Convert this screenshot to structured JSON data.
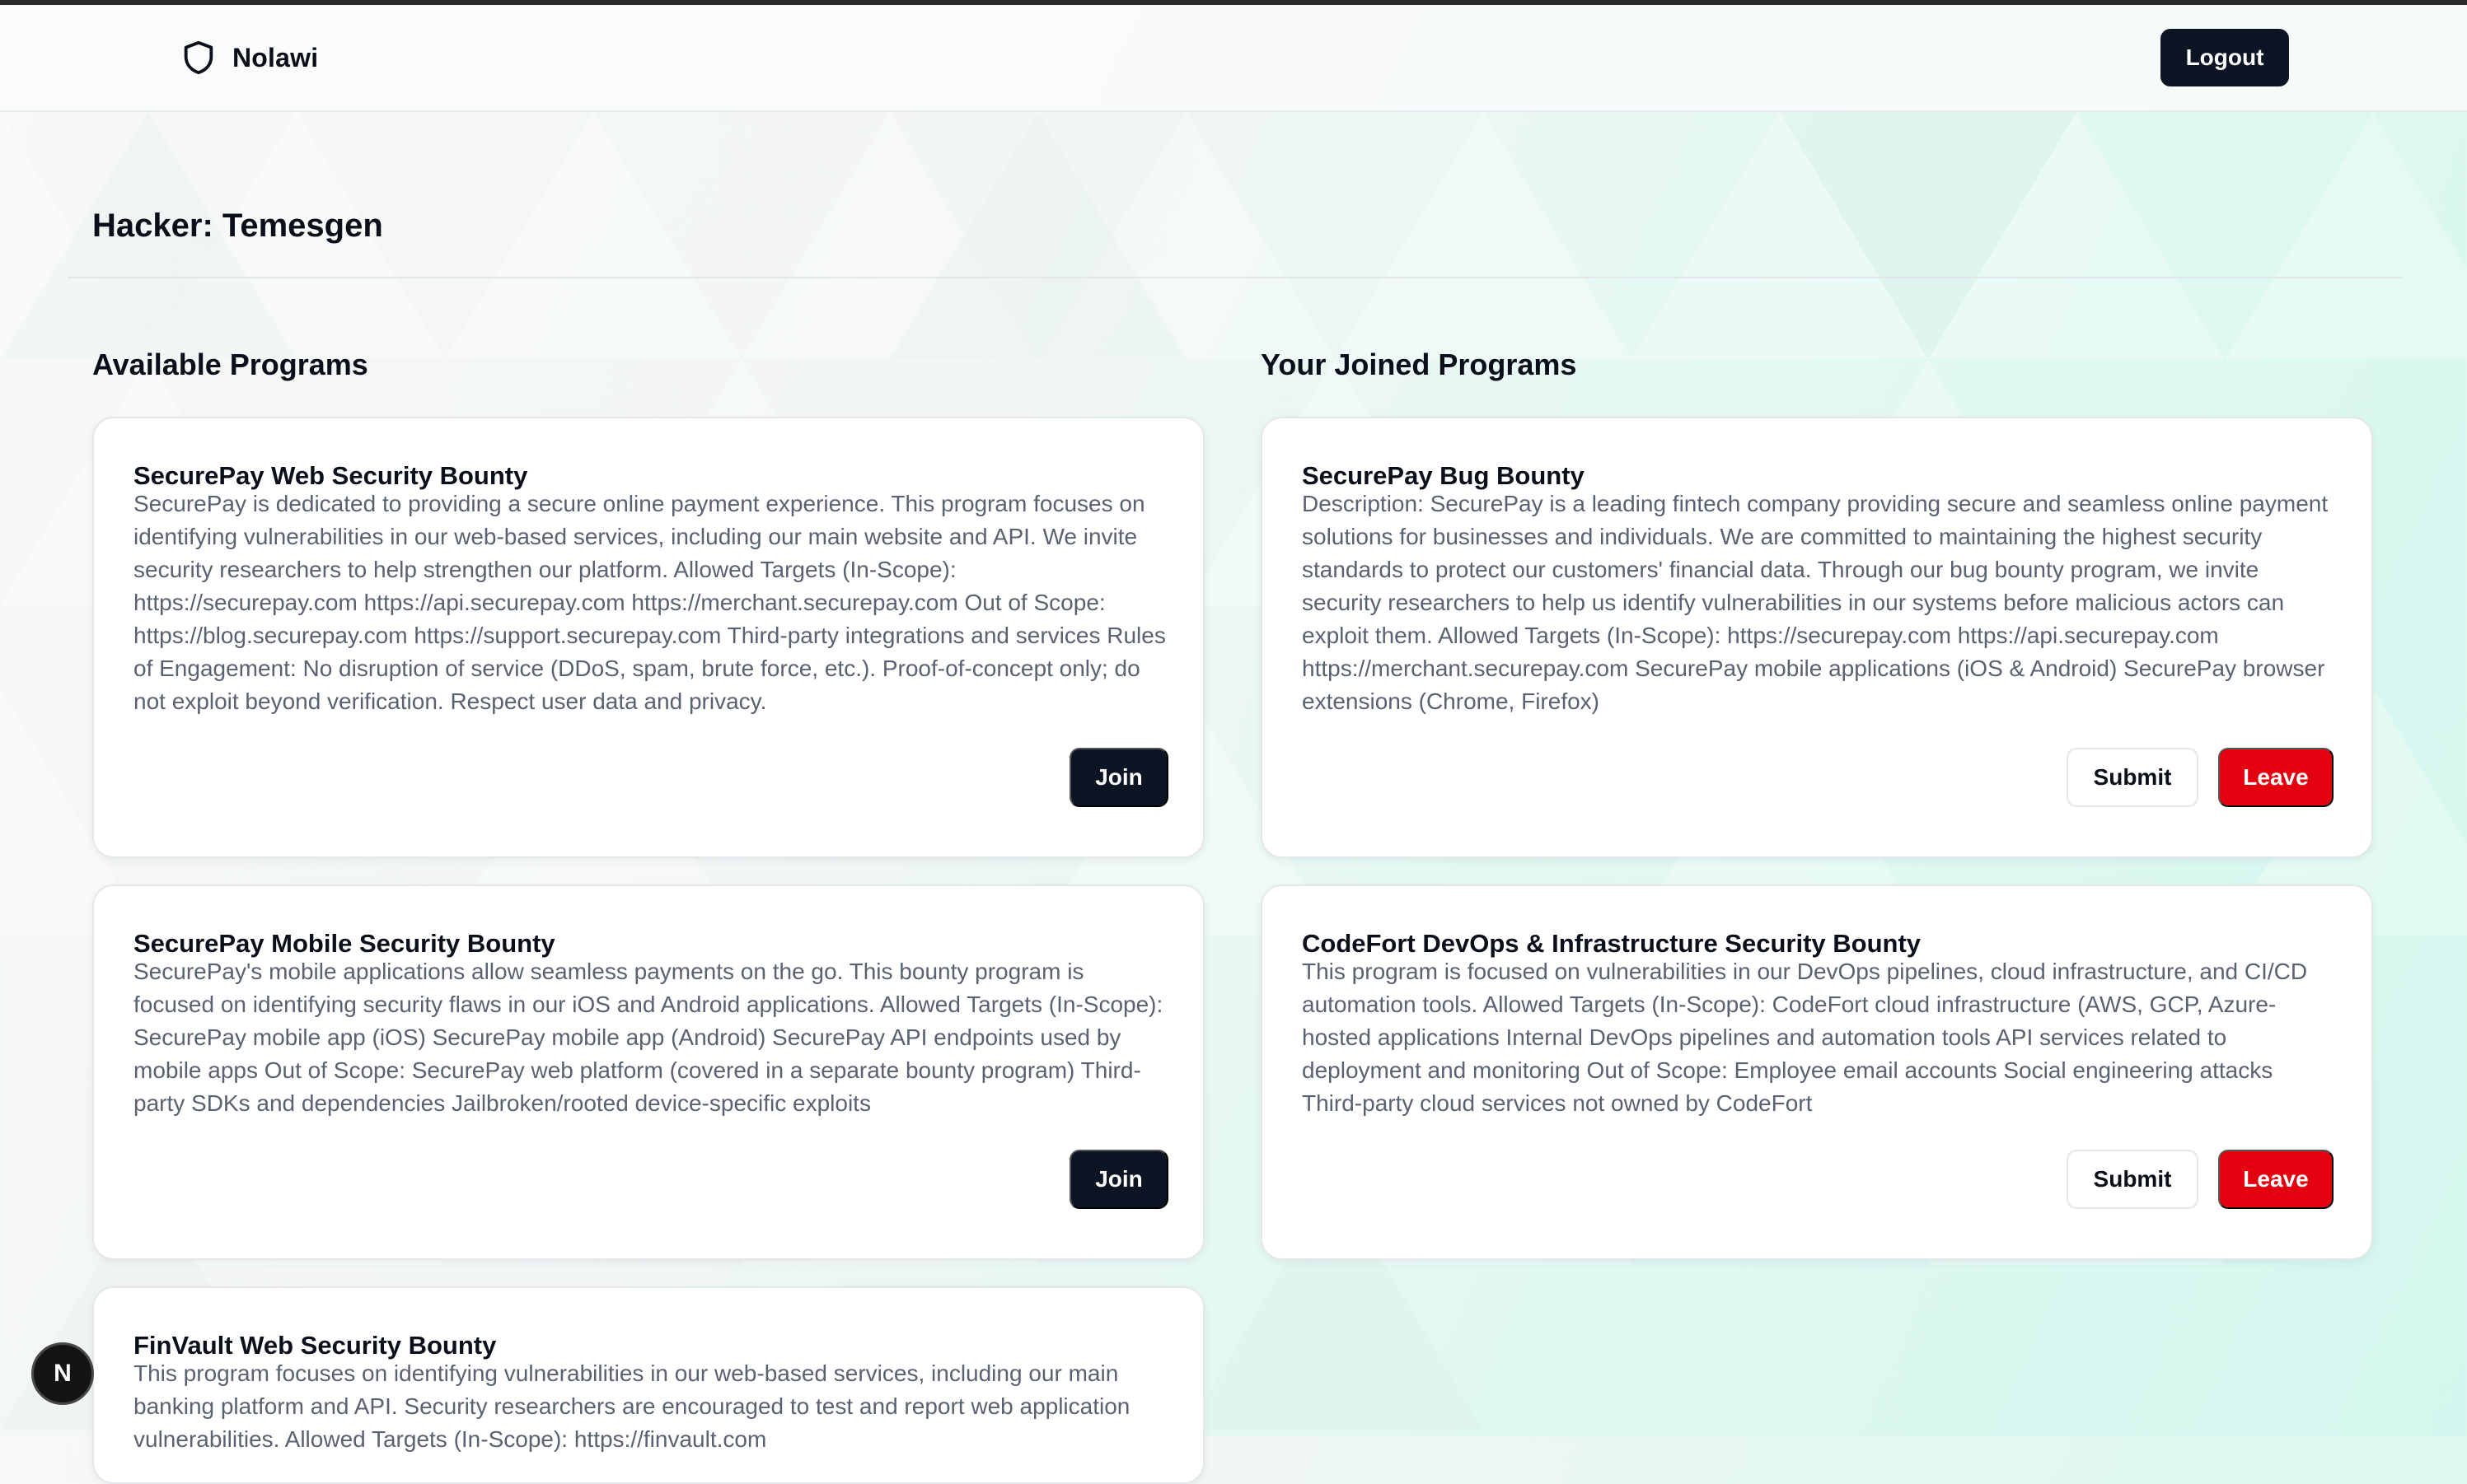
{
  "navbar": {
    "brand_name": "Nolawi",
    "brand_icon": "shield-icon",
    "logout_label": "Logout"
  },
  "page": {
    "title": "Hacker: Temesgen"
  },
  "available": {
    "heading": "Available Programs",
    "programs": [
      {
        "title": "SecurePay Web Security Bounty",
        "description": "SecurePay is dedicated to providing a secure online payment experience. This program focuses on identifying vulnerabilities in our web-based services, including our main website and API. We invite security researchers to help strengthen our platform. Allowed Targets (In-Scope): https://securepay.com https://api.securepay.com https://merchant.securepay.com Out of Scope: https://blog.securepay.com https://support.securepay.com Third-party integrations and services Rules of Engagement: No disruption of service (DDoS, spam, brute force, etc.). Proof-of-concept only; do not exploit beyond verification. Respect user data and privacy.",
        "join_label": "Join"
      },
      {
        "title": "SecurePay Mobile Security Bounty",
        "description": "SecurePay's mobile applications allow seamless payments on the go. This bounty program is focused on identifying security flaws in our iOS and Android applications. Allowed Targets (In-Scope): SecurePay mobile app (iOS) SecurePay mobile app (Android) SecurePay API endpoints used by mobile apps Out of Scope: SecurePay web platform (covered in a separate bounty program) Third-party SDKs and dependencies Jailbroken/rooted device-specific exploits",
        "join_label": "Join"
      },
      {
        "title": "FinVault Web Security Bounty",
        "description": "This program focuses on identifying vulnerabilities in our web-based services, including our main banking platform and API. Security researchers are encouraged to test and report web application vulnerabilities. Allowed Targets (In-Scope): https://finvault.com"
      }
    ]
  },
  "joined": {
    "heading": "Your Joined Programs",
    "programs": [
      {
        "title": "SecurePay Bug Bounty",
        "description": "Description: SecurePay is a leading fintech company providing secure and seamless online payment solutions for businesses and individuals. We are committed to maintaining the highest security standards to protect our customers' financial data. Through our bug bounty program, we invite security researchers to help us identify vulnerabilities in our systems before malicious actors can exploit them. Allowed Targets (In-Scope): https://securepay.com https://api.securepay.com https://merchant.securepay.com SecurePay mobile applications (iOS & Android) SecurePay browser extensions (Chrome, Firefox)",
        "submit_label": "Submit",
        "leave_label": "Leave"
      },
      {
        "title": "CodeFort DevOps & Infrastructure Security Bounty",
        "description": "This program is focused on vulnerabilities in our DevOps pipelines, cloud infrastructure, and CI/CD automation tools. Allowed Targets (In-Scope): CodeFort cloud infrastructure (AWS, GCP, Azure-hosted applications Internal DevOps pipelines and automation tools API services related to deployment and monitoring Out of Scope: Employee email accounts Social engineering attacks Third-party cloud services not owned by CodeFort",
        "submit_label": "Submit",
        "leave_label": "Leave"
      }
    ]
  },
  "dev_badge": {
    "label": "N",
    "icon": "nextjs-icon"
  },
  "colors": {
    "primary_dark": "#0d1424",
    "danger": "#e3000f",
    "muted_text": "#5a6170",
    "background_tint": "#d3f7ee"
  }
}
